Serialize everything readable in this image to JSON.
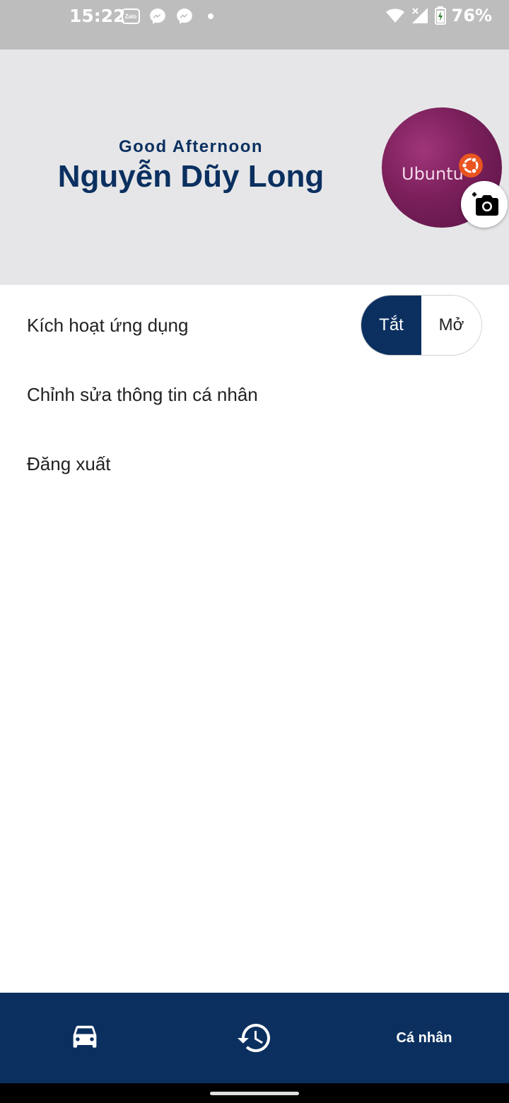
{
  "status_bar": {
    "time": "15:22",
    "zalo_label": "Zalo",
    "battery": "76%",
    "icons_left": [
      "zalo-icon",
      "messenger-icon",
      "messenger-icon",
      "dot-icon"
    ],
    "icons_right": [
      "wifi-icon",
      "signal-icon",
      "battery-charging-icon"
    ]
  },
  "header": {
    "greeting": "Good Afternoon",
    "name": "Nguyễn Dũy Long",
    "avatar_text": "Ubuntu"
  },
  "menu": {
    "activate_label": "Kích hoạt ứng dụng",
    "toggle_off": "Tắt",
    "toggle_on": "Mở",
    "toggle_state": "off",
    "edit_profile": "Chỉnh sửa thông tin cá nhân",
    "logout": "Đăng xuất"
  },
  "bottom_nav": {
    "items": [
      {
        "icon": "car-icon"
      },
      {
        "icon": "history-icon"
      },
      {
        "label": "Cá nhân"
      }
    ]
  },
  "colors": {
    "primary": "#0b3060",
    "header_bg": "#e6e6e8",
    "status_bar_bg": "#bdbdbd"
  }
}
